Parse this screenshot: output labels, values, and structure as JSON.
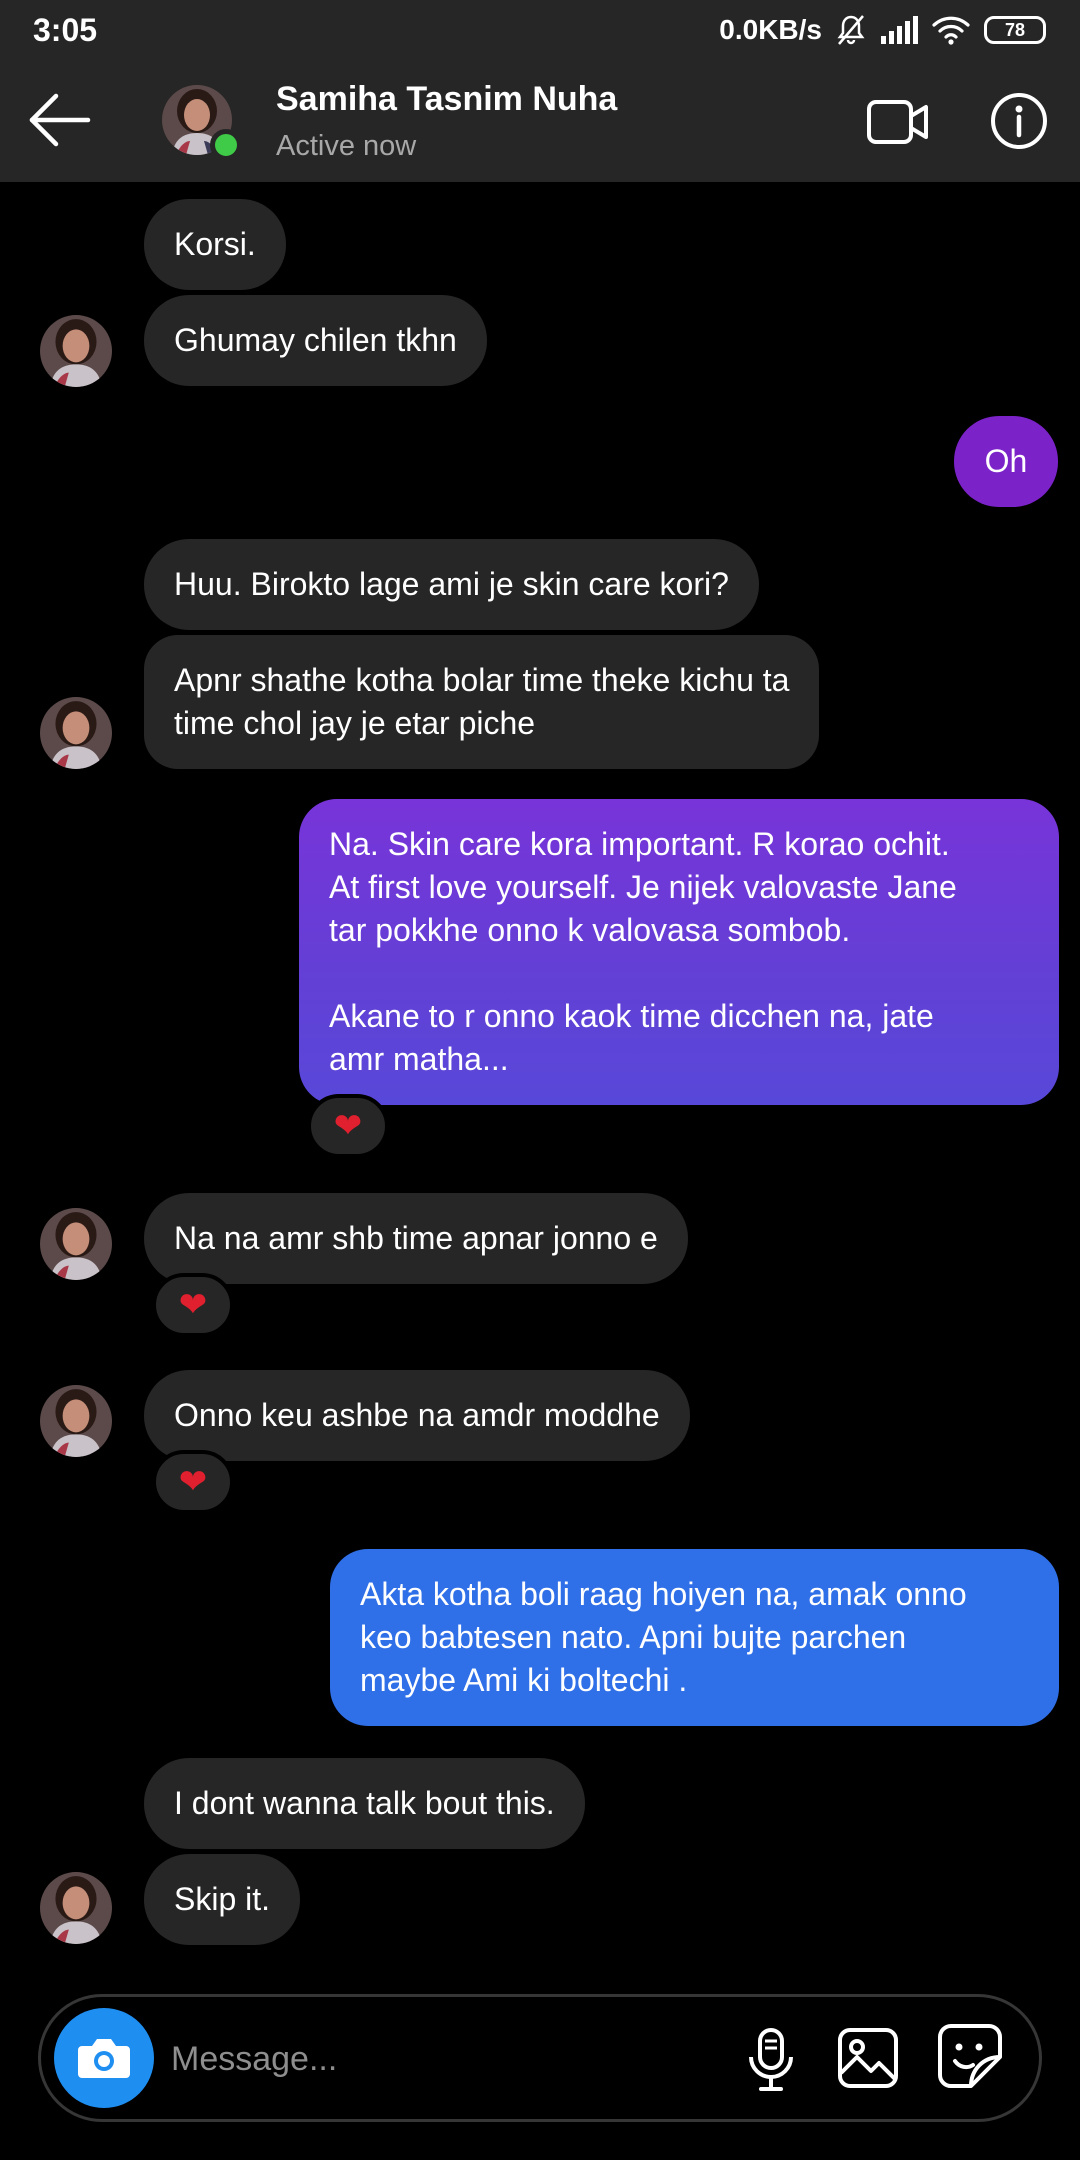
{
  "status_bar": {
    "time": "3:05",
    "network_speed": "0.0KB/s",
    "battery": "78"
  },
  "header": {
    "contact_name": "Samiha Tasnim Nuha",
    "contact_status": "Active now"
  },
  "messages": [
    {
      "sender": "contact",
      "text": "Korsi."
    },
    {
      "sender": "contact",
      "text": "Ghumay chilen tkhn"
    },
    {
      "sender": "me",
      "text": "Oh"
    },
    {
      "sender": "contact",
      "text": "Huu. Birokto lage ami je skin care kori?"
    },
    {
      "sender": "contact",
      "text": "Apnr shathe kotha bolar time theke kichu ta\ntime chol jay je etar piche"
    },
    {
      "sender": "me",
      "text": "Na. Skin care kora important. R korao ochit.\nAt first love yourself. Je nijek valovaste Jane\ntar pokkhe onno k valovasa sombob.\n\nAkane to r onno kaok time dicchen na, jate\namr matha...",
      "reaction": "❤"
    },
    {
      "sender": "contact",
      "text": "Na na amr shb time apnar jonno e",
      "reaction": "❤"
    },
    {
      "sender": "contact",
      "text": "Onno keu ashbe na amdr moddhe",
      "reaction": "❤"
    },
    {
      "sender": "me",
      "text": "Akta kotha boli raag hoiyen na, amak onno\nkeo babtesen nato. Apni bujte parchen\nmaybe Ami ki boltechi ."
    },
    {
      "sender": "contact",
      "text": "I dont wanna talk bout this."
    },
    {
      "sender": "contact",
      "text": "Skip it."
    }
  ],
  "composer": {
    "placeholder": "Message..."
  },
  "colors": {
    "header_bg": "#262626",
    "incoming_bubble": "#262626",
    "outgoing_purple": "#7b22c9",
    "outgoing_blue": "#2f6fe8",
    "online_dot": "#3fca47",
    "camera_button": "#1f8ef1",
    "heart": "#e0202e"
  },
  "icons": {
    "back": "arrow-left-icon",
    "video": "video-camera-icon",
    "info": "info-icon",
    "camera": "camera-icon",
    "mic": "microphone-icon",
    "gallery": "image-icon",
    "sticker": "sticker-icon"
  }
}
